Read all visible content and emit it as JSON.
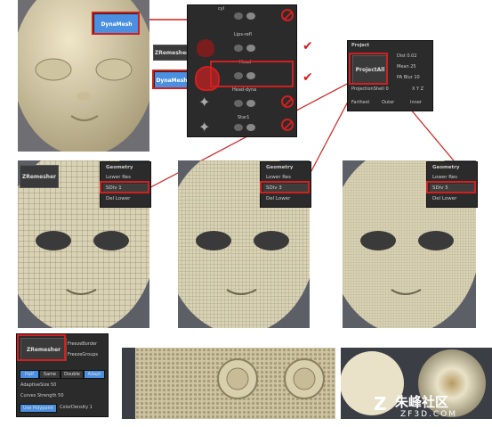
{
  "colors": {
    "accent_red": "#d21f1f",
    "button_blue": "#4a8fe0",
    "panel": "#2b2b2b",
    "mesh": "#d9d2b4"
  },
  "buttons": {
    "dynamesh": "DynaMesh",
    "zremesher": "ZRemesher",
    "dynamesh2": "DynaMesh",
    "zremesher_bottom": "ZRemesher"
  },
  "subtools": {
    "items": [
      {
        "label": "cyl"
      },
      {
        "label": "Lips-refl"
      },
      {
        "label": "Head"
      },
      {
        "label": "Head-dyna"
      },
      {
        "label": "Star1"
      }
    ],
    "icons": [
      "no-icon",
      "check-icon",
      "check-icon",
      "no-icon",
      "no-icon"
    ]
  },
  "project": {
    "title": "Project",
    "project_all": "ProjectAll",
    "dist": "Dist 0.02",
    "mean": "Mean 25",
    "pa_blur": "PA Blur 10",
    "proj_shell": "ProjectionShell 0",
    "xyz": "X Y Z",
    "farthest": "Farthest",
    "outer": "Outer",
    "inner": "Inner"
  },
  "geometry1": {
    "title": "Geometry",
    "lower": "Lower Res",
    "sdiv": "SDiv 1",
    "del": "Del Lower"
  },
  "geometry2": {
    "title": "Geometry",
    "lower": "Lower Res",
    "sdiv": "SDiv 3",
    "del": "Del Lower"
  },
  "geometry3": {
    "title": "Geometry",
    "lower": "Lower Res",
    "sdiv": "SDiv 5",
    "del": "Del Lower"
  },
  "zremesh_panel": {
    "freeze_border": "FreezeBorder",
    "freeze_groups": "FreezeGroups",
    "half": "Half",
    "same": "Same",
    "double": "Double",
    "adapt": "Adapt",
    "adaptive_size": "AdaptiveSize 50",
    "curves_strength": "Curves Strength 50",
    "use_polypaint": "Use Polypaint",
    "color_density": "ColorDensity 1"
  },
  "watermark": {
    "cn": "朱峰社区",
    "url": "ZF3D.COM"
  }
}
